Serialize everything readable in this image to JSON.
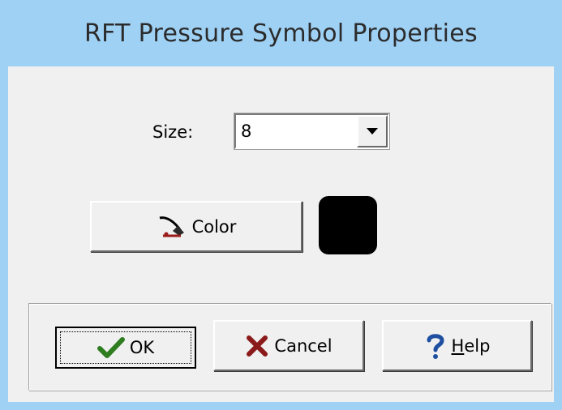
{
  "window": {
    "title": "RFT Pressure Symbol Properties"
  },
  "size": {
    "label": "Size:",
    "value": "8"
  },
  "color": {
    "button_label": "Color",
    "swatch_color": "#000000",
    "icon": "paint-brush-icon"
  },
  "buttons": {
    "ok_label": "OK",
    "ok_icon": "checkmark-icon",
    "cancel_label": "Cancel",
    "cancel_icon": "x-icon",
    "help_prefix": "H",
    "help_rest": "elp",
    "help_icon": "question-mark-icon"
  },
  "theme": {
    "titlebar_color": "#9fd1f5",
    "client_color": "#f0f0f0",
    "ok_check_color": "#2e7d1f",
    "cancel_x_color": "#8b1a1a",
    "help_q_color": "#1f4fa0"
  }
}
